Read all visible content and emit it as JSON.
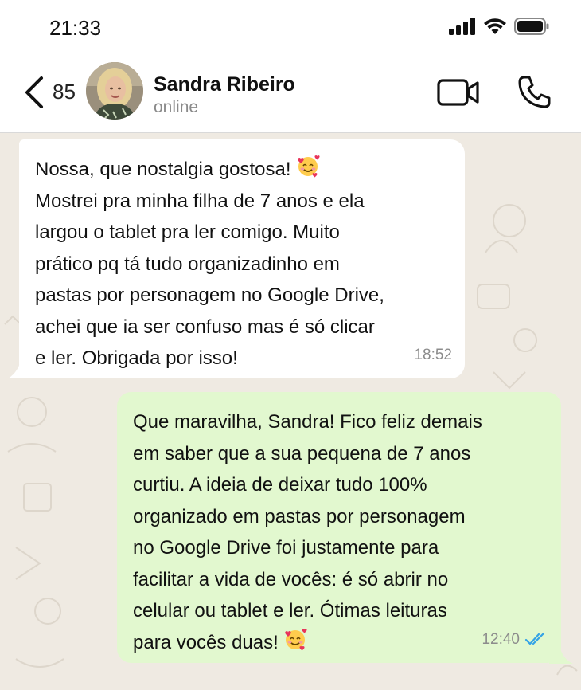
{
  "status_bar": {
    "time": "21:33"
  },
  "header": {
    "back_count": "85",
    "contact_name": "Sandra Ribeiro",
    "contact_status": "online"
  },
  "messages": [
    {
      "direction": "incoming",
      "lines": [
        "Nossa, que nostalgia gostosa! ",
        "Mostrei pra minha filha de 7 anos e ela",
        "largou o tablet pra ler comigo. Muito",
        "prático pq tá tudo organizadinho em",
        "pastas por personagem no Google Drive,",
        "achei que ia ser confuso mas é só clicar",
        "e ler. Obrigada por isso!"
      ],
      "emoji": "smiling-face-with-hearts",
      "time": "18:52"
    },
    {
      "direction": "outgoing",
      "lines": [
        "Que maravilha, Sandra! Fico feliz demais",
        "em saber que a sua pequena de 7 anos",
        "curtiu. A ideia de deixar tudo 100%",
        "organizado em pastas por personagem",
        "no Google Drive foi justamente para",
        "facilitar a vida de vocês: é só abrir no",
        "celular ou tablet e ler. Ótimas leituras",
        "para vocês duas! "
      ],
      "emoji": "smiling-face-with-hearts",
      "time": "12:40",
      "read_receipt": "double-check-blue"
    }
  ],
  "colors": {
    "incoming_bubble": "#ffffff",
    "outgoing_bubble": "#e2f8cf",
    "chat_background": "#efeae2",
    "read_check": "#34a3e6"
  }
}
